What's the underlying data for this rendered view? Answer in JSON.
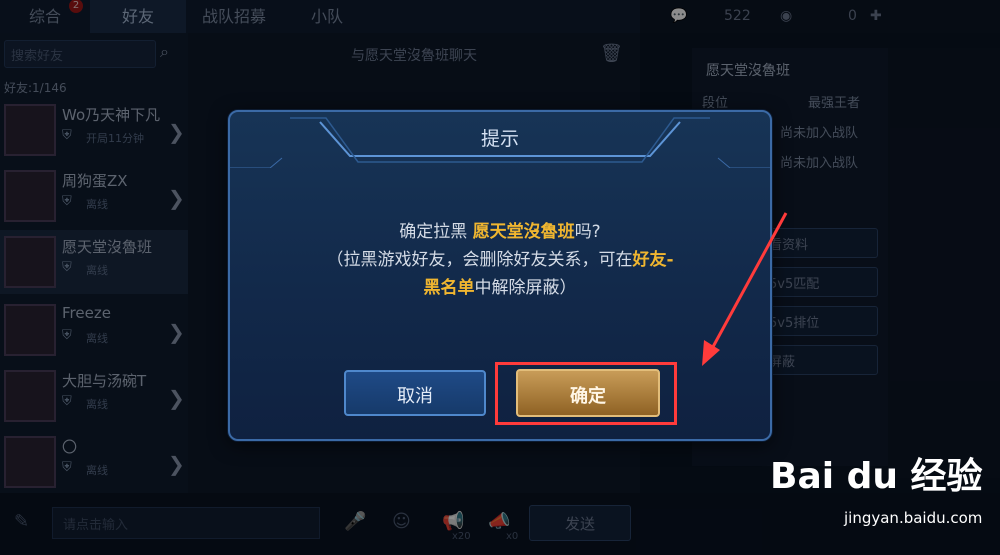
{
  "tabs": [
    {
      "label": "综合",
      "badge": "2"
    },
    {
      "label": "好友"
    },
    {
      "label": "战队招募"
    },
    {
      "label": "小队"
    }
  ],
  "topbar": {
    "count1": "522",
    "count2": "0"
  },
  "left_panel": {
    "search_placeholder": "搜索好友",
    "friend_count": "好友:1/146",
    "friends": [
      {
        "name": "Wo乃天神下凡",
        "status": "开局11分钟"
      },
      {
        "name": "周狗蛋ZX",
        "status": "离线"
      },
      {
        "name": "愿天堂沒魯班",
        "status": "离线"
      },
      {
        "name": "Freeze",
        "status": "离线"
      },
      {
        "name": "大胆与汤碗T",
        "status": "离线"
      },
      {
        "name": "〇",
        "status": "离线"
      }
    ]
  },
  "chat": {
    "title": "与愿天堂沒魯班聊天",
    "input_placeholder": "请点击输入",
    "send_label": "发送",
    "x20": "x20",
    "x0": "x0"
  },
  "profile": {
    "name": "愿天堂沒魯班",
    "rank_label": "段位",
    "rank_value": "最强王者",
    "team1": "尚未加入战队",
    "team2": "尚未加入战队",
    "buttons": [
      "看资料",
      "5v5匹配",
      "5v5排位",
      "屏蔽"
    ]
  },
  "dialog": {
    "title": "提示",
    "line1_prefix": "确定拉黑 ",
    "line1_name": "愿天堂沒魯班",
    "line1_suffix": "吗?",
    "line2_prefix": "（拉黑游戏好友，会删除好友关系，可在",
    "line2_hl": "好友-",
    "line3_hl": "黑名单",
    "line3_suffix": "中解除屏蔽）",
    "cancel_label": "取消",
    "confirm_label": "确定"
  },
  "watermark": {
    "brand": "Bai du 经验",
    "url": "jingyan.baidu.com"
  },
  "colors": {
    "highlight": "#f0b630",
    "annotation": "#ff3b3b",
    "confirm": "#b8894a",
    "cancel": "#1f4a86"
  }
}
